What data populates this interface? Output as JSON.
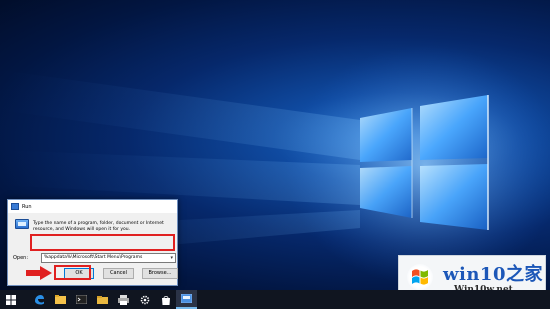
{
  "run_dialog": {
    "title": "Run",
    "description": "Type the name of a program, folder, document or Internet resource, and Windows will open it for you.",
    "open_label": "Open:",
    "open_value": "%appdata%\\Microsoft\\Start Menu\\Programs",
    "ok_label": "OK",
    "cancel_label": "Cancel",
    "browse_label": "Browse..."
  },
  "watermark": {
    "title": "win10之家",
    "url": "Win10w.net"
  },
  "taskbar": {
    "items": [
      "start-icon",
      "edge-icon",
      "file-explorer-icon",
      "cmd-icon",
      "folder-icon",
      "printer-icon",
      "settings-icon",
      "store-icon",
      "run-icon"
    ]
  },
  "colors": {
    "annotation_red": "#e02020",
    "wallpaper_blue": "#0f4aa0",
    "taskbar": "#101520"
  }
}
